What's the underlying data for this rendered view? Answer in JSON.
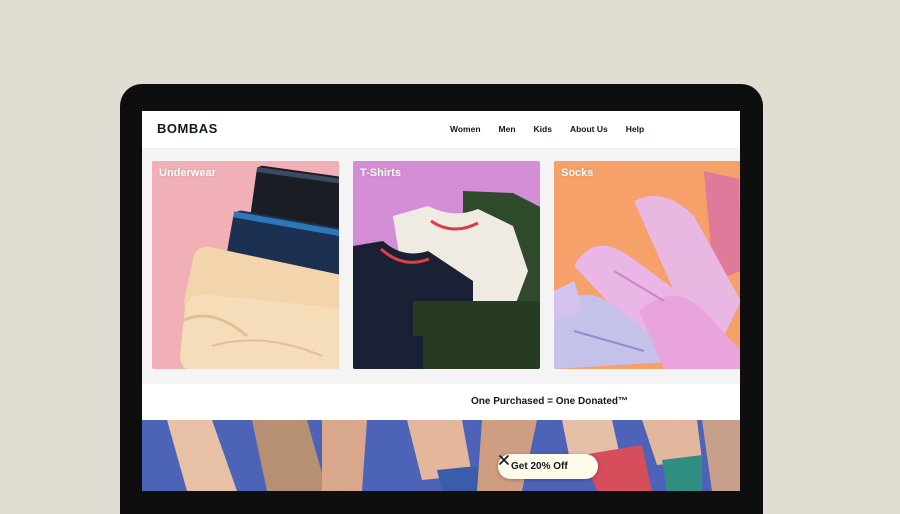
{
  "header": {
    "logo": "BOMBAS",
    "nav": [
      "Women",
      "Men",
      "Kids",
      "About Us",
      "Help"
    ]
  },
  "categories": [
    {
      "label": "Underwear",
      "bg": "#f0b0b5"
    },
    {
      "label": "T-Shirts",
      "bg": "#d38ed5"
    },
    {
      "label": "Socks",
      "bg": "#f6a06a"
    }
  ],
  "mission": {
    "text": "One Purchased = One Donated™"
  },
  "promo": {
    "label": "Get 20% Off",
    "close_icon": "close-icon"
  },
  "colors": {
    "background": "#e2ddd3",
    "laptop_frame": "#0e0e0e",
    "hero": "#4d63b7",
    "promo_bg": "#fffbea",
    "text": "#101820"
  }
}
